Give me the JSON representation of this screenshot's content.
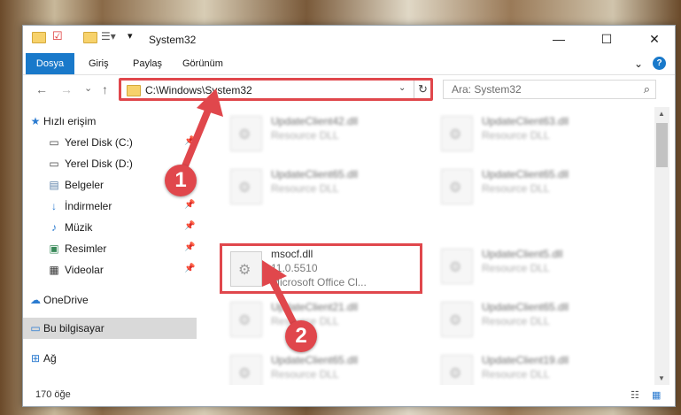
{
  "window": {
    "title": "System32",
    "minimize": "—",
    "maximize": "☐",
    "close": "✕"
  },
  "ribbon": {
    "tabs": [
      "Dosya",
      "Giriş",
      "Paylaş",
      "Görünüm"
    ],
    "expand": "⌄",
    "help": "?"
  },
  "nav": {
    "back": "←",
    "forward": "→",
    "recent": "⌄",
    "up": "↑",
    "address": "C:\\Windows\\System32",
    "address_dropdown": "⌄",
    "refresh": "↻",
    "search_placeholder": "Ara: System32",
    "search_icon": "⌕"
  },
  "sidebar": {
    "items": [
      {
        "label": "Hızlı erişim",
        "icon": "star-icon"
      },
      {
        "label": "Yerel Disk (C:)",
        "icon": "drive-icon",
        "pin": "📌"
      },
      {
        "label": "Yerel Disk (D:)",
        "icon": "drive-icon",
        "pin": ""
      },
      {
        "label": "Belgeler",
        "icon": "document-icon",
        "pin": "📌"
      },
      {
        "label": "İndirmeler",
        "icon": "download-icon",
        "pin": "📌"
      },
      {
        "label": "Müzik",
        "icon": "music-icon",
        "pin": "📌"
      },
      {
        "label": "Resimler",
        "icon": "pictures-icon",
        "pin": "📌"
      },
      {
        "label": "Videolar",
        "icon": "video-icon",
        "pin": "📌"
      },
      {
        "label": "OneDrive",
        "icon": "cloud-icon"
      },
      {
        "label": "Bu bilgisayar",
        "icon": "computer-icon"
      },
      {
        "label": "Ağ",
        "icon": "network-icon"
      }
    ]
  },
  "files": {
    "left": [
      {
        "name": "UpdateClient42.dll",
        "type": "Resource DLL"
      },
      {
        "name": "UpdateClient65.dll",
        "type": "Resource DLL"
      },
      {
        "name": "msocf.dll",
        "version": "11.0.5510",
        "desc": "Microsoft Office Cl..."
      },
      {
        "name": "UpdateClient21.dll",
        "type": "Resource DLL"
      },
      {
        "name": "UpdateClient65.dll",
        "type": "Resource DLL"
      }
    ],
    "right": [
      {
        "name": "UpdateClient63.dll",
        "type": "Resource DLL"
      },
      {
        "name": "UpdateClient65.dll",
        "type": "Resource DLL"
      },
      {
        "name": "UpdateClient5.dll",
        "type": "Resource DLL"
      },
      {
        "name": "UpdateClient65.dll",
        "type": "Resource DLL"
      },
      {
        "name": "UpdateClient19.dll",
        "type": "Resource DLL"
      }
    ]
  },
  "status": {
    "count": "170 öğe",
    "details_view": "☷",
    "tiles_view": "▦"
  },
  "annotations": {
    "step1": "1",
    "step2": "2",
    "highlight_color": "#e0474c"
  }
}
